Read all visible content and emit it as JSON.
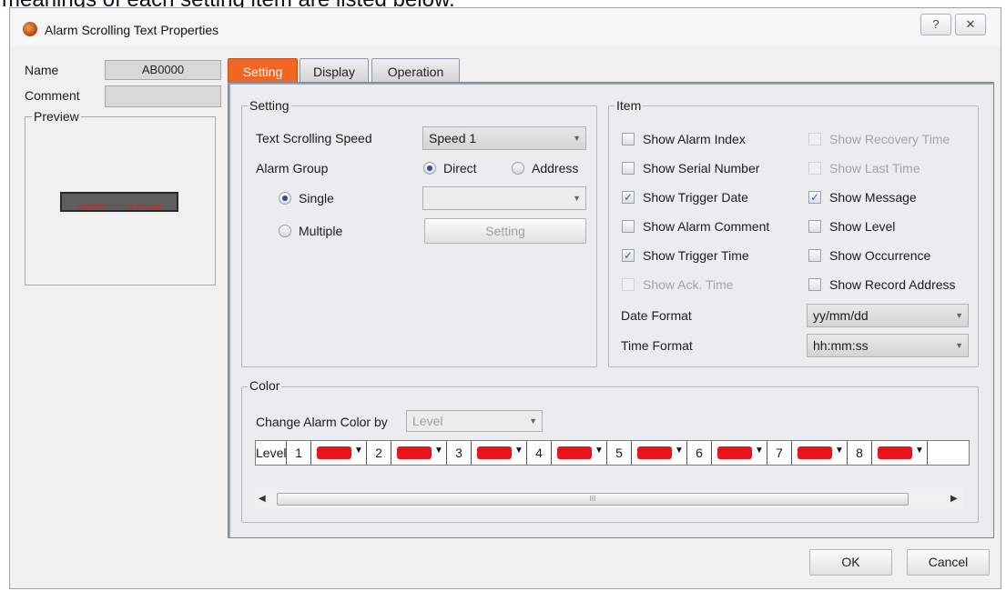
{
  "caption": "meanings of each setting item are listed below.",
  "window": {
    "title": "Alarm Scrolling Text Properties",
    "help_glyph": "?",
    "close_glyph": "✕"
  },
  "left": {
    "name_label": "Name",
    "name_value": "AB0000",
    "comment_label": "Comment",
    "comment_value": "",
    "preview_label": "Preview",
    "preview_text": "yy/mm/dd hh:mm:ss Message"
  },
  "tabs": [
    {
      "label": "Setting",
      "active": true
    },
    {
      "label": "Display",
      "active": false
    },
    {
      "label": "Operation",
      "active": false
    }
  ],
  "setting": {
    "group_title": "Setting",
    "speed_label": "Text Scrolling Speed",
    "speed_value": "Speed 1",
    "alarm_group_label": "Alarm Group",
    "direct_label": "Direct",
    "address_label": "Address",
    "single_label": "Single",
    "single_value": "",
    "multiple_label": "Multiple",
    "setting_button": "Setting"
  },
  "item": {
    "group_title": "Item",
    "checkboxes": [
      {
        "label": "Show Alarm Index",
        "checked": false,
        "enabled": true
      },
      {
        "label": "Show Recovery Time",
        "checked": false,
        "enabled": false
      },
      {
        "label": "Show Serial Number",
        "checked": false,
        "enabled": true
      },
      {
        "label": "Show Last Time",
        "checked": false,
        "enabled": false
      },
      {
        "label": "Show Trigger Date",
        "checked": true,
        "enabled": true
      },
      {
        "label": "Show Message",
        "checked": true,
        "enabled": true
      },
      {
        "label": "Show Alarm Comment",
        "checked": false,
        "enabled": true
      },
      {
        "label": "Show Level",
        "checked": false,
        "enabled": true
      },
      {
        "label": "Show Trigger Time",
        "checked": true,
        "enabled": true
      },
      {
        "label": "Show Occurrence",
        "checked": false,
        "enabled": true
      },
      {
        "label": "Show Ack. Time",
        "checked": false,
        "enabled": false
      },
      {
        "label": "Show Record Address",
        "checked": false,
        "enabled": true
      }
    ],
    "date_format_label": "Date Format",
    "date_format_value": "yy/mm/dd",
    "time_format_label": "Time Format",
    "time_format_value": "hh:mm:ss"
  },
  "color": {
    "group_title": "Color",
    "change_by_label": "Change Alarm Color by",
    "change_by_value": "Level",
    "level_header": "Level",
    "levels": [
      "1",
      "2",
      "3",
      "4",
      "5",
      "6",
      "7",
      "8"
    ],
    "swatch_color": "#e8141c",
    "scroll_thumb_glyph": "III"
  },
  "buttons": {
    "ok": "OK",
    "cancel": "Cancel"
  }
}
